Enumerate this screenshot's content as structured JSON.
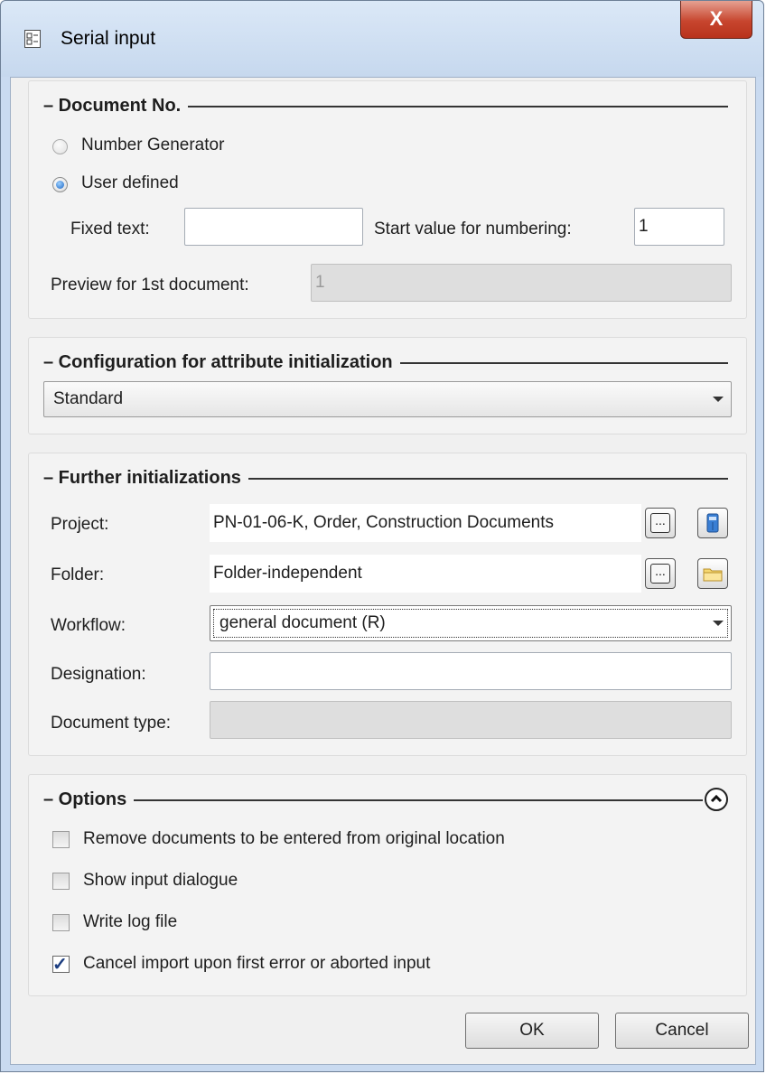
{
  "window": {
    "title": "Serial input",
    "close_glyph": "X"
  },
  "document_no": {
    "header": "– Document No.",
    "radio_number_generator": "Number Generator",
    "radio_user_defined": "User defined",
    "selected": "User defined",
    "fixed_text_label": "Fixed text:",
    "fixed_text_value": "",
    "start_value_label": "Start value for numbering:",
    "start_value": "1",
    "preview_label": "Preview for 1st document:",
    "preview_value": "1"
  },
  "configuration": {
    "header": "– Configuration for attribute initialization",
    "selected": "Standard"
  },
  "further": {
    "header": "– Further initializations",
    "project_label": "Project:",
    "project_value": "PN-01-06-K, Order, Construction Documents",
    "folder_label": "Folder:",
    "folder_value": "Folder-independent",
    "workflow_label": "Workflow:",
    "workflow_value": "general document (R)",
    "designation_label": "Designation:",
    "designation_value": "",
    "document_type_label": "Document type:",
    "document_type_value": "",
    "browse_glyph": "..."
  },
  "options": {
    "header": "– Options",
    "items": [
      {
        "label": "Remove documents to be entered from original location",
        "checked": false
      },
      {
        "label": "Show input dialogue",
        "checked": false
      },
      {
        "label": "Write log file",
        "checked": false
      },
      {
        "label": "Cancel import upon first error or aborted input",
        "checked": true
      }
    ]
  },
  "footer": {
    "ok_label": "OK",
    "cancel_label": "Cancel"
  },
  "colors": {
    "frame": "#c9daf0",
    "close_button": "#c7452e",
    "radio_selected": "#1a64c4"
  },
  "icons": {
    "window": "document-list-icon",
    "project_extra": "binder-icon",
    "folder_extra": "folder-icon",
    "options_collapse": "chevron-up-circle-icon"
  }
}
